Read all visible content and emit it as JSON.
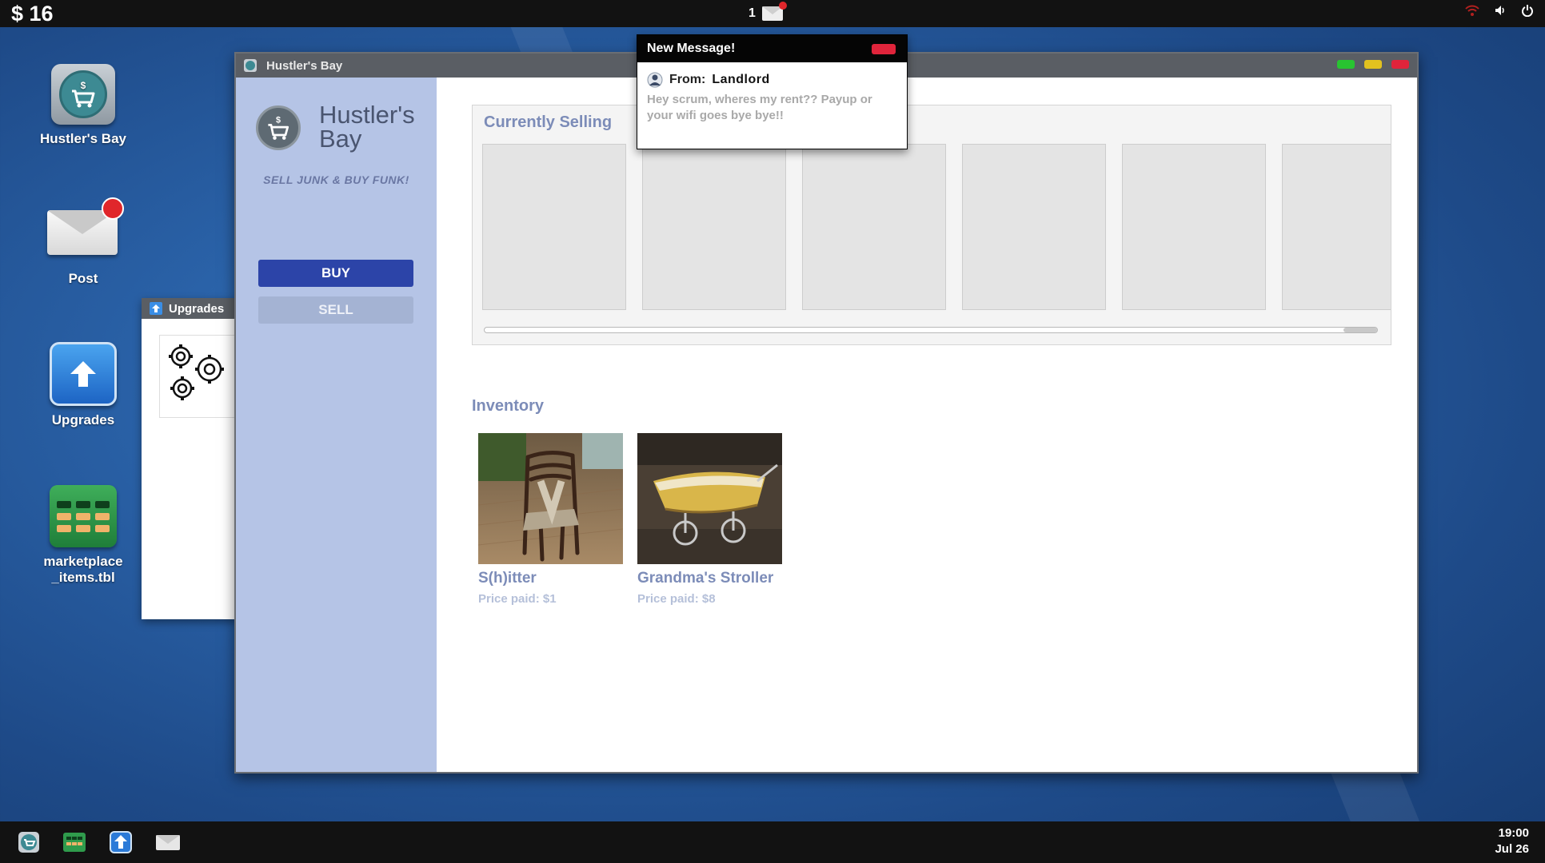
{
  "topbar": {
    "money": "$ 16",
    "notification_count": "1"
  },
  "desktop": {
    "icons": [
      {
        "label": "Hustler's Bay",
        "icon": "shopping-cart-icon"
      },
      {
        "label": "Post",
        "icon": "mail-envelope-icon"
      },
      {
        "label": "Upgrades",
        "icon": "upload-arrow-icon"
      },
      {
        "label": "marketplace\n_items.tbl",
        "icon": "table-file-icon"
      }
    ]
  },
  "upgrades_window": {
    "title": "Upgrades"
  },
  "window": {
    "title": "Hustler's Bay",
    "app_name": "Hustler's Bay",
    "tagline": "SELL JUNK & BUY FUNK!",
    "buy_label": "BUY",
    "sell_label": "SELL",
    "currently_selling_title": "Currently Selling",
    "inventory_title": "Inventory",
    "inventory": [
      {
        "name": "S(h)itter",
        "price": "Price paid: $1"
      },
      {
        "name": "Grandma's Stroller",
        "price": "Price paid: $8"
      }
    ]
  },
  "message": {
    "header": "New Message!",
    "from_label": "From:",
    "from_name": "Landlord",
    "body": "Hey scrum, wheres my rent?? Payup or your wifi goes bye bye!!"
  },
  "clock": {
    "time": "19:00",
    "date": "Jul 26"
  },
  "colors": {
    "accent": "#2c44a8",
    "sidebar": "#b5c4e6",
    "close": "#e0243b",
    "minimize": "#e2c21f",
    "maximize": "#28c431"
  }
}
